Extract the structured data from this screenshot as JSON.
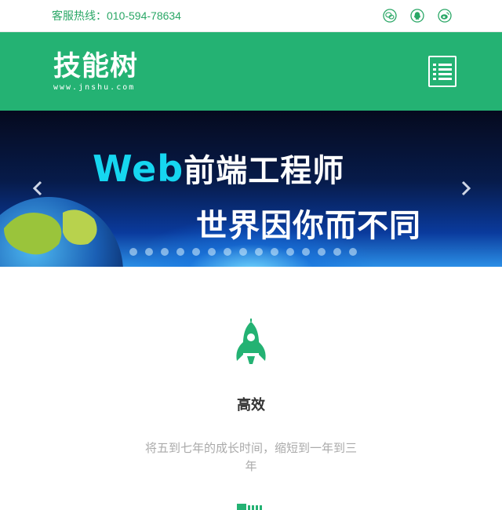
{
  "topbar": {
    "hotline": "客服热线：010-594-78634",
    "social_icons": [
      "wechat-icon",
      "qq-icon",
      "weibo-icon"
    ]
  },
  "header": {
    "logo_text": "技能树",
    "logo_subtext": "www.jnshu.com",
    "menu_icon": "hamburger-menu-icon"
  },
  "banner": {
    "line1_accent": "Web",
    "line1_rest": "前端工程师",
    "line2": "世界因你而不同",
    "prev_icon": "chevron-left-icon",
    "next_icon": "chevron-right-icon"
  },
  "features": [
    {
      "icon": "rocket-icon",
      "title": "高效",
      "description": "将五到七年的成长时间，缩短到一年到三年"
    }
  ],
  "colors": {
    "brand_green": "#24b273",
    "hotline_green": "#2aa766",
    "muted_text": "#aaaaaa"
  }
}
